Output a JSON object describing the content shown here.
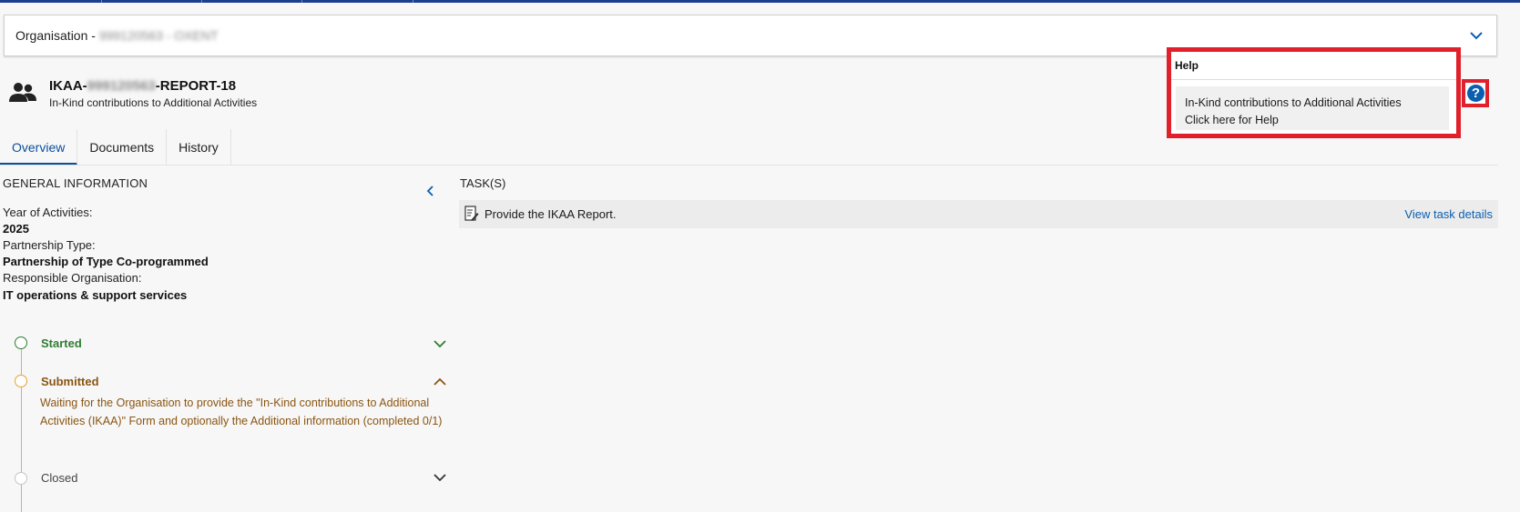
{
  "org_bar": {
    "prefix": "Organisation - ",
    "redacted": "999120563 - OXENT"
  },
  "report": {
    "title_prefix": "IKAA-",
    "title_redacted": "999120563",
    "title_suffix": "-REPORT-18",
    "subtitle": "In-Kind contributions to Additional Activities"
  },
  "tabs": [
    {
      "label": "Overview",
      "active": true
    },
    {
      "label": "Documents",
      "active": false
    },
    {
      "label": "History",
      "active": false
    }
  ],
  "help": {
    "title": "Help",
    "line1": "In-Kind contributions to Additional Activities",
    "line2": "Click here for Help",
    "button": "?"
  },
  "general": {
    "title": "GENERAL INFORMATION",
    "year_label": "Year of Activities:",
    "year_value": "2025",
    "partnership_label": "Partnership Type:",
    "partnership_value": "Partnership of Type Co-programmed",
    "resp_label": "Responsible Organisation:",
    "resp_value": "IT operations & support services"
  },
  "timeline": {
    "started": "Started",
    "submitted": "Submitted",
    "submitted_desc": "Waiting for the Organisation to provide the \"In-Kind contributions to Additional Activities (IKAA)\" Form and optionally the Additional information (completed 0/1)",
    "closed": "Closed"
  },
  "tasks": {
    "title": "TASK(S)",
    "items": [
      {
        "text": "Provide the IKAA Report.",
        "link": "View task details"
      }
    ]
  },
  "colors": {
    "accent_blue": "#0b4f9e",
    "started_green": "#2e7d32",
    "submitted_orange": "#e8a030",
    "highlight_red": "#e0202a"
  }
}
